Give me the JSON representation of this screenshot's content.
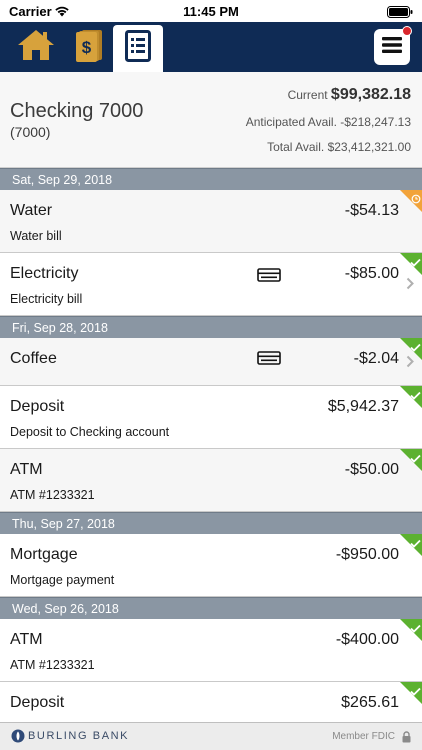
{
  "status_bar": {
    "carrier": "Carrier",
    "time": "11:45 PM"
  },
  "nav": {
    "tabs": [
      {
        "icon": "home-icon"
      },
      {
        "icon": "money-cards-icon"
      },
      {
        "icon": "statement-icon",
        "active": true
      }
    ],
    "menu_icon": "hamburger-menu-icon",
    "has_notification": true
  },
  "account": {
    "name": "Checking 7000",
    "number": "(7000)",
    "current_label": "Current",
    "current_value": "$99,382.18",
    "anticipated_label": "Anticipated Avail.",
    "anticipated_value": "-$218,247.13",
    "total_label": "Total Avail.",
    "total_value": "$23,412,321.00"
  },
  "groups": [
    {
      "date": "Sat, Sep 29, 2018",
      "transactions": [
        {
          "title": "Water",
          "description": "Water bill",
          "amount": "-$54.13",
          "status": "pending",
          "card": false,
          "chevron": false
        },
        {
          "title": "Electricity",
          "description": "Electricity bill",
          "amount": "-$85.00",
          "status": "cleared",
          "card": true,
          "chevron": true
        }
      ]
    },
    {
      "date": "Fri, Sep 28, 2018",
      "transactions": [
        {
          "title": "Coffee",
          "description": "",
          "amount": "-$2.04",
          "status": "cleared",
          "card": true,
          "chevron": true
        },
        {
          "title": "Deposit",
          "description": "Deposit to Checking account",
          "amount": "$5,942.37",
          "status": "cleared",
          "card": false,
          "chevron": false
        },
        {
          "title": "ATM",
          "description": "ATM #1233321",
          "amount": "-$50.00",
          "status": "cleared",
          "card": false,
          "chevron": false
        }
      ]
    },
    {
      "date": "Thu, Sep 27, 2018",
      "transactions": [
        {
          "title": "Mortgage",
          "description": "Mortgage payment",
          "amount": "-$950.00",
          "status": "cleared",
          "card": false,
          "chevron": false
        }
      ]
    },
    {
      "date": "Wed, Sep 26, 2018",
      "transactions": [
        {
          "title": "ATM",
          "description": "ATM #1233321",
          "amount": "-$400.00",
          "status": "cleared",
          "card": false,
          "chevron": false
        },
        {
          "title": "Deposit",
          "description": "",
          "amount": "$265.61",
          "status": "cleared",
          "card": false,
          "chevron": false
        }
      ]
    }
  ],
  "footer": {
    "bank_name": "BURLING BANK",
    "fdic": "Member FDIC"
  },
  "colors": {
    "nav": "#0f2b55",
    "gold": "#d7a23c",
    "cleared": "#5cb130",
    "pending": "#f2a33a",
    "date_header": "#8a96a3"
  }
}
